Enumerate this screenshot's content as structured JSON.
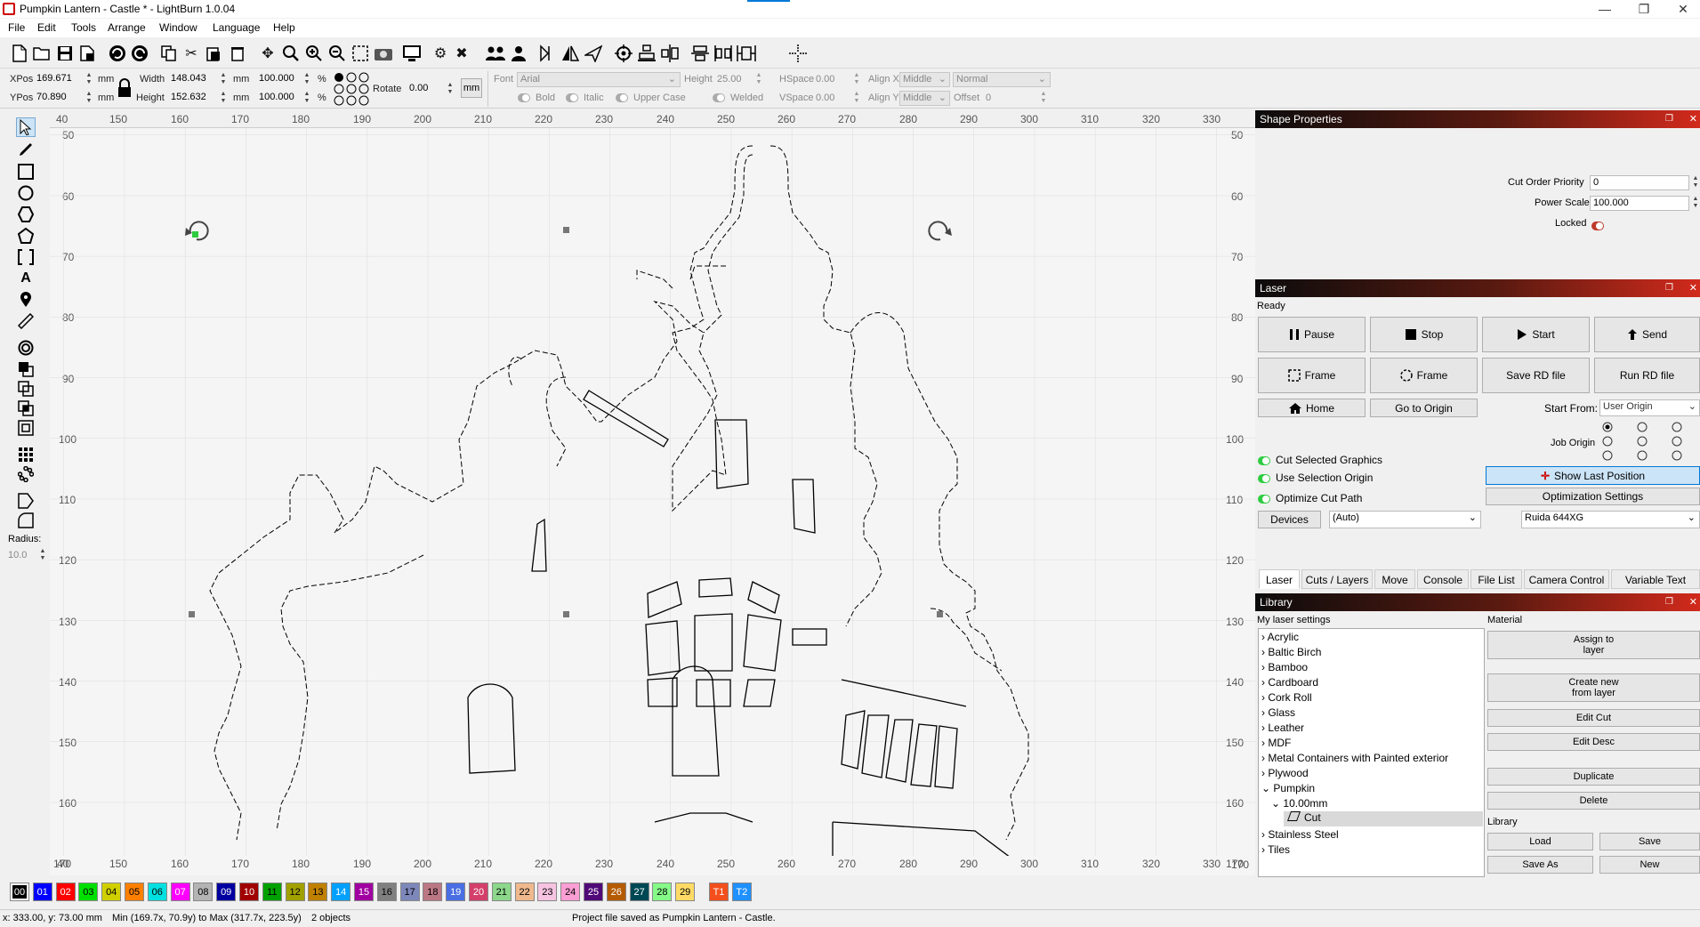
{
  "window": {
    "title": "Pumpkin Lantern - Castle * - LightBurn 1.0.04",
    "minimize_glyph": "—",
    "restore_glyph": "❐",
    "close_glyph": "✕"
  },
  "menu": [
    "File",
    "Edit",
    "Tools",
    "Arrange",
    "Window",
    "Language",
    "Help"
  ],
  "toolbar_icons": [
    "new-file-icon",
    "open-folder-icon",
    "save-icon",
    "save-as-icon",
    "undo-icon",
    "redo-icon",
    "copy-icon",
    "cut-icon",
    "paste-icon",
    "delete-icon",
    "move-icon",
    "zoom-in-icon",
    "zoom-fit-icon",
    "zoom-out-icon",
    "zoom-selection-icon",
    "camera-icon",
    "monitor-icon",
    "settings-icon",
    "tools-icon",
    "group-icon",
    "user-icon",
    "mirror-horizontal-icon",
    "mirror-vertical-icon",
    "send-icon",
    "target-icon",
    "align-icon",
    "distribute-icon",
    "align-vertical-icon",
    "spacing-icon",
    "ruler-icon",
    "crosshair-icon"
  ],
  "props": {
    "xpos_label": "XPos",
    "xpos": "169.671",
    "ypos_label": "YPos",
    "ypos": "70.890",
    "unit": "mm",
    "width_label": "Width",
    "width": "148.043",
    "height_label": "Height",
    "height": "152.632",
    "scale_w": "100.000",
    "scale_h": "100.000",
    "percent": "%",
    "rotate_label": "Rotate",
    "rotate": "0.00",
    "rotate_unit": "mm",
    "font_label": "Font",
    "font_value": "Arial",
    "font_height_label": "Height",
    "font_height": "25.00",
    "hspace_label": "HSpace",
    "hspace": "0.00",
    "vspace_label": "VSpace",
    "vspace": "0.00",
    "alignx_label": "Align X",
    "alignx": "Middle",
    "aligny_label": "Align Y",
    "aligny": "Middle",
    "style": "Normal",
    "offset_label": "Offset",
    "offset": "0",
    "bold": "Bold",
    "italic": "Italic",
    "upper_case": "Upper Case",
    "welded": "Welded"
  },
  "left_tools": {
    "radius_label": "Radius:",
    "radius_value": "10.0"
  },
  "ruler": {
    "top": [
      "40",
      "150",
      "160",
      "170",
      "180",
      "190",
      "200",
      "210",
      "220",
      "230",
      "240",
      "250",
      "260",
      "270",
      "280",
      "290",
      "300",
      "310",
      "320",
      "330"
    ],
    "left": [
      "50",
      "60",
      "70",
      "80",
      "90",
      "100",
      "110",
      "120",
      "130",
      "140",
      "150",
      "160"
    ],
    "right": [
      "50",
      "60",
      "70",
      "80",
      "90",
      "100",
      "110",
      "120",
      "130",
      "140",
      "150",
      "160",
      "170"
    ],
    "bottom": [
      "40",
      "150",
      "160",
      "170",
      "180",
      "190",
      "200",
      "210",
      "220",
      "230",
      "240",
      "250",
      "260",
      "270",
      "280",
      "290",
      "300",
      "310",
      "320",
      "330",
      "170",
      "170"
    ]
  },
  "palette": [
    {
      "label": "00",
      "color": "#000000",
      "fg": "#ffffff"
    },
    {
      "label": "01",
      "color": "#0000ff",
      "fg": "#ffffff"
    },
    {
      "label": "02",
      "color": "#ff0000",
      "fg": "#ffffff"
    },
    {
      "label": "03",
      "color": "#00e000",
      "fg": "#000000"
    },
    {
      "label": "04",
      "color": "#d0d000",
      "fg": "#000000"
    },
    {
      "label": "05",
      "color": "#ff8000",
      "fg": "#000000"
    },
    {
      "label": "06",
      "color": "#00e0e0",
      "fg": "#000000"
    },
    {
      "label": "07",
      "color": "#ff00ff",
      "fg": "#ffffff"
    },
    {
      "label": "08",
      "color": "#b4b4b4",
      "fg": "#000000"
    },
    {
      "label": "09",
      "color": "#0000a0",
      "fg": "#ffffff"
    },
    {
      "label": "10",
      "color": "#a00000",
      "fg": "#ffffff"
    },
    {
      "label": "11",
      "color": "#00a000",
      "fg": "#000000"
    },
    {
      "label": "12",
      "color": "#a0a000",
      "fg": "#000000"
    },
    {
      "label": "13",
      "color": "#c08000",
      "fg": "#000000"
    },
    {
      "label": "14",
      "color": "#00a0ff",
      "fg": "#ffffff"
    },
    {
      "label": "15",
      "color": "#a000a0",
      "fg": "#ffffff"
    },
    {
      "label": "16",
      "color": "#808080",
      "fg": "#000000"
    },
    {
      "label": "17",
      "color": "#7d87b9",
      "fg": "#000000"
    },
    {
      "label": "18",
      "color": "#bb7784",
      "fg": "#000000"
    },
    {
      "label": "19",
      "color": "#4a6fe3",
      "fg": "#ffffff"
    },
    {
      "label": "20",
      "color": "#d33f6a",
      "fg": "#ffffff"
    },
    {
      "label": "21",
      "color": "#8cd78c",
      "fg": "#000000"
    },
    {
      "label": "22",
      "color": "#f0b98d",
      "fg": "#000000"
    },
    {
      "label": "23",
      "color": "#f6c4e1",
      "fg": "#000000"
    },
    {
      "label": "24",
      "color": "#fa9ed4",
      "fg": "#000000"
    },
    {
      "label": "25",
      "color": "#500a78",
      "fg": "#ffffff"
    },
    {
      "label": "26",
      "color": "#b45a00",
      "fg": "#ffffff"
    },
    {
      "label": "27",
      "color": "#004754",
      "fg": "#ffffff"
    },
    {
      "label": "28",
      "color": "#86fa88",
      "fg": "#000000"
    },
    {
      "label": "29",
      "color": "#ffdb66",
      "fg": "#000000"
    },
    {
      "label": "T1",
      "color": "#f34f1c",
      "fg": "#ffffff"
    },
    {
      "label": "T2",
      "color": "#1e90ff",
      "fg": "#ffffff"
    }
  ],
  "status": {
    "coords": "x: 333.00, y: 73.00 mm",
    "range": "Min (169.7x, 70.9y) to Max (317.7x, 223.5y)",
    "objects": "2 objects",
    "message": "Project file saved as Pumpkin Lantern - Castle."
  },
  "shape_properties": {
    "title": "Shape Properties",
    "cut_order_label": "Cut Order Priority",
    "cut_order": "0",
    "power_scale_label": "Power Scale",
    "power_scale": "100.000",
    "locked_label": "Locked"
  },
  "laser": {
    "title": "Laser",
    "status": "Ready",
    "pause": "Pause",
    "stop": "Stop",
    "start": "Start",
    "send": "Send",
    "frame1": "Frame",
    "frame2": "Frame",
    "save_rd": "Save RD file",
    "run_rd": "Run RD file",
    "home": "Home",
    "go_origin": "Go to Origin",
    "start_from_label": "Start From:",
    "start_from": "User Origin",
    "job_origin_label": "Job Origin",
    "cut_selected": "Cut Selected Graphics",
    "use_selection_origin": "Use Selection Origin",
    "optimize_cut_path": "Optimize Cut Path",
    "show_last_position": "Show Last Position",
    "optimization_settings": "Optimization Settings",
    "devices": "Devices",
    "device_port": "(Auto)",
    "device_name": "Ruida 644XG"
  },
  "tabs": [
    "Laser",
    "Cuts / Layers",
    "Move",
    "Console",
    "File List",
    "Camera Control",
    "Variable Text"
  ],
  "library": {
    "title": "Library",
    "my_settings_label": "My laser settings",
    "material_label": "Material",
    "library_label": "Library",
    "items": [
      "Acrylic",
      "Baltic Birch",
      "Bamboo",
      "Cardboard",
      "Cork Roll",
      "Glass",
      "Leather",
      "MDF",
      "Metal Containers with Painted exterior",
      "Plywood",
      "Pumpkin"
    ],
    "sub_item": "10.00mm",
    "leaf_item": "Cut",
    "items_after": [
      "Stainless Steel",
      "Tiles"
    ],
    "assign_line1": "Assign to",
    "assign_line2": "layer",
    "create_line1": "Create new",
    "create_line2": "from layer",
    "edit_cut": "Edit Cut",
    "edit_desc": "Edit Desc",
    "duplicate": "Duplicate",
    "delete": "Delete",
    "load": "Load",
    "save": "Save",
    "save_as": "Save As",
    "new": "New"
  }
}
